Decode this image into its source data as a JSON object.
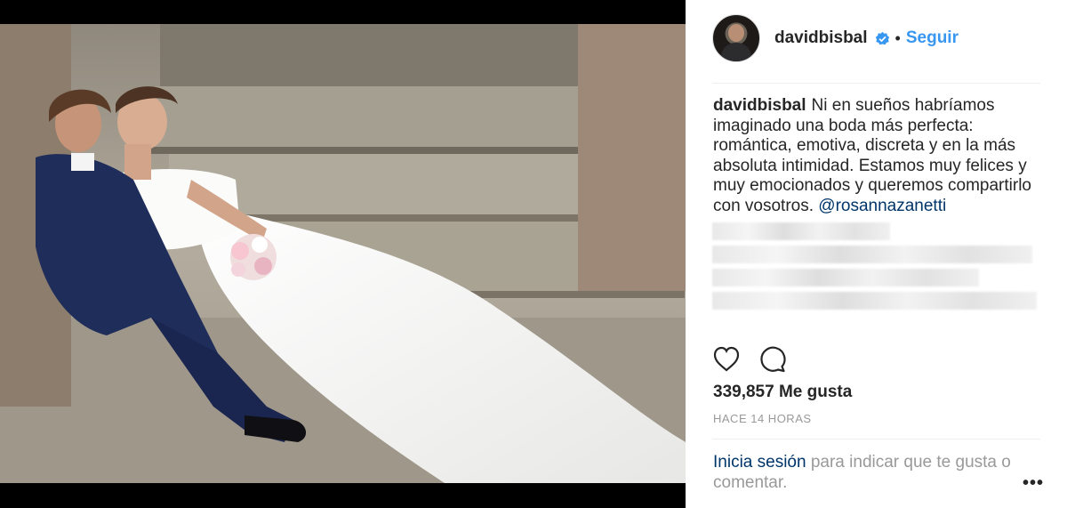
{
  "post": {
    "username": "davidbisbal",
    "dot": "•",
    "follow_label": "Seguir",
    "caption": "Ni en sueños habríamos imaginado una boda más perfecta: romántica, emotiva, discreta y en la más absoluta intimidad. Estamos muy felices y muy emocionados y queremos compartirlo con vosotros.",
    "mention": "@rosannazanetti",
    "likes": "339,857 Me gusta",
    "time": "HACE 14 HORAS",
    "login_link": "Inicia sesión",
    "login_rest": "para indicar que te gusta o comentar.",
    "more": "•••"
  },
  "icons": {
    "verified": "verified-badge-icon",
    "like": "heart-icon",
    "comment": "comment-bubble-icon",
    "more": "more-options-icon"
  },
  "colors": {
    "accent": "#3897f0",
    "text": "#262626",
    "muted": "#999999",
    "link": "#003569"
  }
}
